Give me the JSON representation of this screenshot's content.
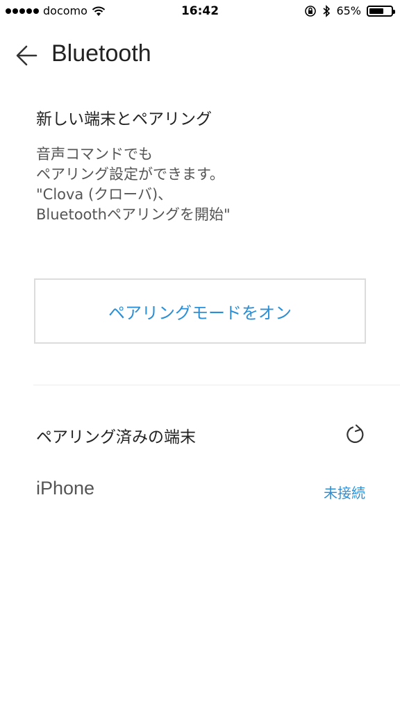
{
  "status_bar": {
    "carrier": "docomo",
    "time": "16:42",
    "battery_text": "65%",
    "battery_level": 0.65,
    "signal_icon": "signal-dots-icon",
    "wifi_icon": "wifi-icon",
    "rotation_lock_icon": "rotation-lock-icon",
    "bluetooth_icon": "bluetooth-icon"
  },
  "header": {
    "back_icon": "arrow-left-icon",
    "title": "Bluetooth"
  },
  "new_device": {
    "heading": "新しい端末とペアリング",
    "description_lines": [
      "音声コマンドでも",
      "ペアリング設定ができます。",
      "\"Clova (クローバ)、",
      "Bluetoothペアリングを開始\""
    ],
    "pairing_button_label": "ペアリングモードをオン"
  },
  "paired": {
    "heading": "ペアリング済みの端末",
    "refresh_icon": "refresh-icon",
    "devices": [
      {
        "name": "iPhone",
        "status": "未接続"
      }
    ]
  },
  "colors": {
    "accent": "#2b8fd6",
    "text_primary": "#222222",
    "text_secondary": "#555555",
    "border": "#dcdcdc"
  }
}
